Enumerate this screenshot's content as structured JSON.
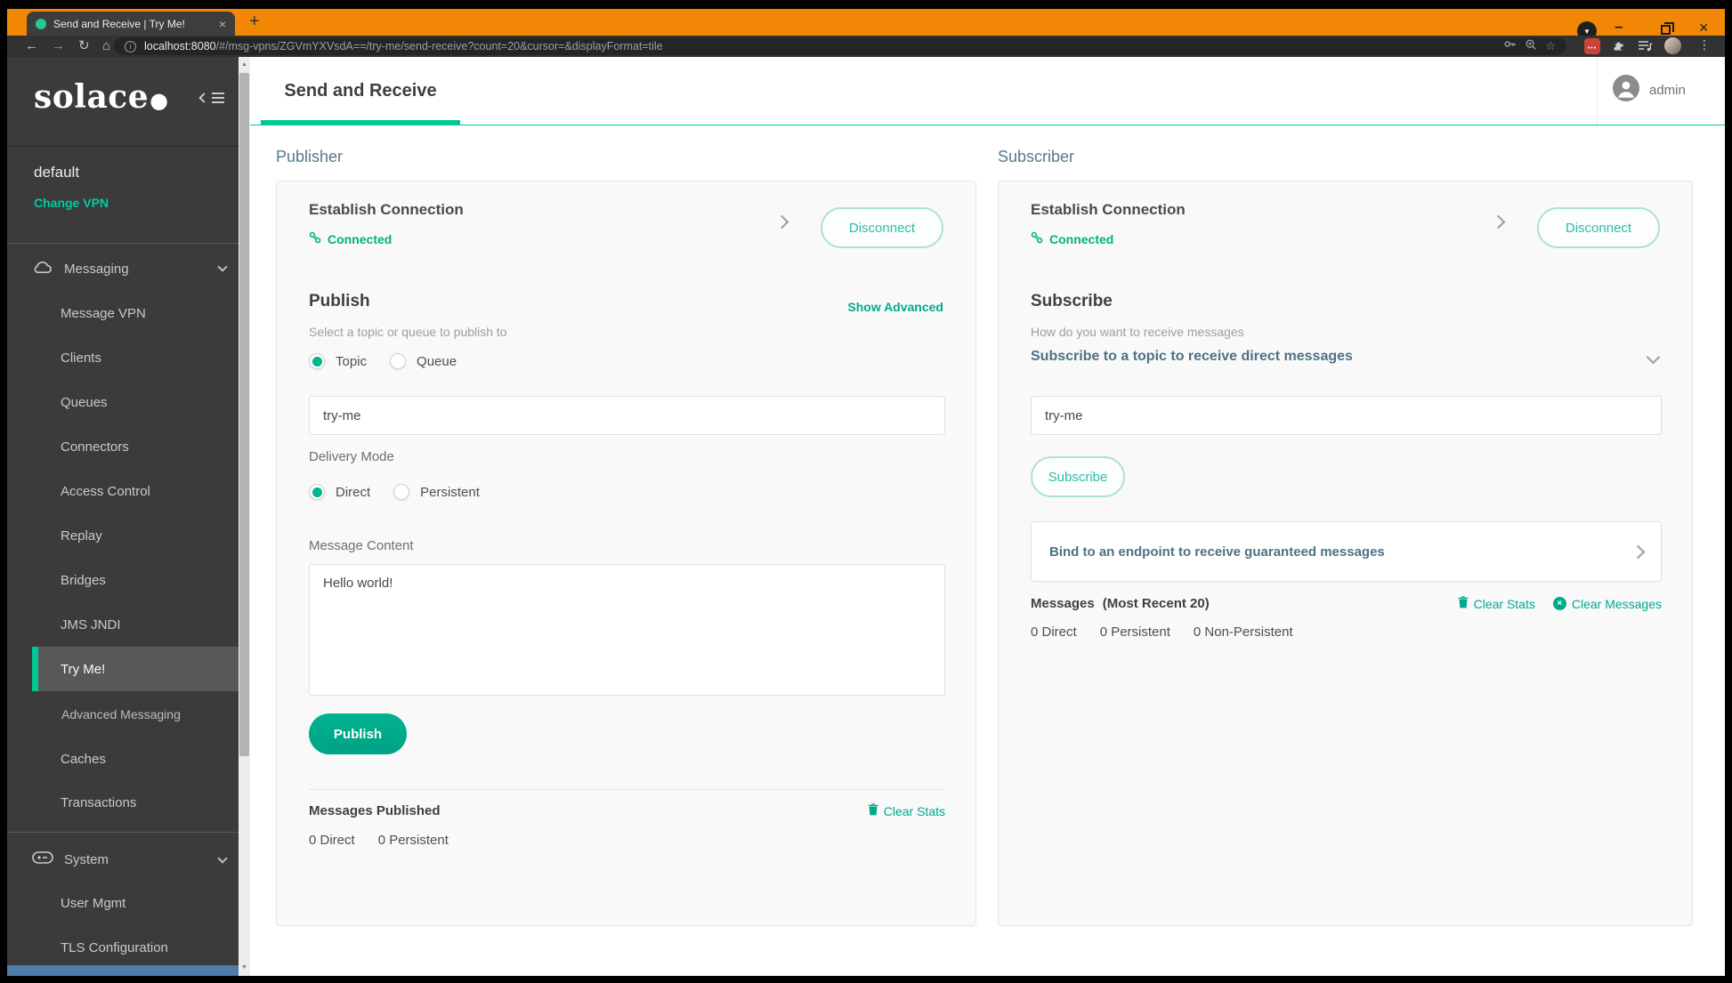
{
  "glyphs": {
    "close": "×",
    "plus": "+",
    "minus": "–",
    "vdots": "⋮",
    "up": "▲",
    "down": "▼",
    "back": "←",
    "forward": "→",
    "reload": "↻",
    "home": "⌂",
    "star": "☆",
    "info": "i",
    "dot": "●",
    "dots": "•••",
    "note": "♪"
  },
  "browser": {
    "tab_title": "Send and Receive | Try Me!",
    "url_host": "localhost:8080",
    "url_path": "/#/msg-vpns/ZGVmYXVsdA==/try-me/send-receive?count=20&cursor=&displayFormat=tile"
  },
  "sidebar": {
    "logo": "solace",
    "vpn": "default",
    "change_vpn": "Change VPN",
    "messaging": "Messaging",
    "items": [
      "Message VPN",
      "Clients",
      "Queues",
      "Connectors",
      "Access Control",
      "Replay",
      "Bridges",
      "JMS JNDI",
      "Try Me!"
    ],
    "advanced": "Advanced Messaging",
    "items2": [
      "Caches",
      "Transactions"
    ],
    "system": "System",
    "system_items": [
      "User Mgmt",
      "TLS Configuration"
    ]
  },
  "header": {
    "title": "Send and Receive",
    "user": "admin"
  },
  "publisher": {
    "heading": "Publisher",
    "connection": {
      "title": "Establish Connection",
      "status": "Connected",
      "action": "Disconnect"
    },
    "publish": {
      "heading": "Publish",
      "advanced": "Show Advanced",
      "subtitle": "Select a topic or queue to publish to",
      "option_topic": "Topic",
      "option_queue": "Queue",
      "topic_value": "try-me",
      "delivery_label": "Delivery Mode",
      "option_direct": "Direct",
      "option_persistent": "Persistent",
      "content_label": "Message Content",
      "content_value": "Hello world!",
      "action": "Publish"
    },
    "stats": {
      "heading": "Messages Published",
      "clear_stats": "Clear Stats",
      "direct": "0 Direct",
      "persistent": "0 Persistent"
    }
  },
  "subscriber": {
    "heading": "Subscriber",
    "connection": {
      "title": "Establish Connection",
      "status": "Connected",
      "action": "Disconnect"
    },
    "subscribe": {
      "heading": "Subscribe",
      "subtitle": "How do you want to receive messages",
      "mode_label": "Subscribe to a topic to receive direct messages",
      "topic_value": "try-me",
      "action": "Subscribe",
      "bind_label": "Bind to an endpoint to receive guaranteed messages"
    },
    "messages": {
      "heading": "Messages",
      "recent": "(Most Recent 20)",
      "clear_stats": "Clear Stats",
      "clear_messages": "Clear Messages",
      "direct": "0 Direct",
      "persistent": "0 Persistent",
      "non_persistent": "0 Non-Persistent"
    }
  },
  "colors": {
    "accent": "#00c895",
    "orange": "#f28705",
    "teal": "#56798b"
  }
}
